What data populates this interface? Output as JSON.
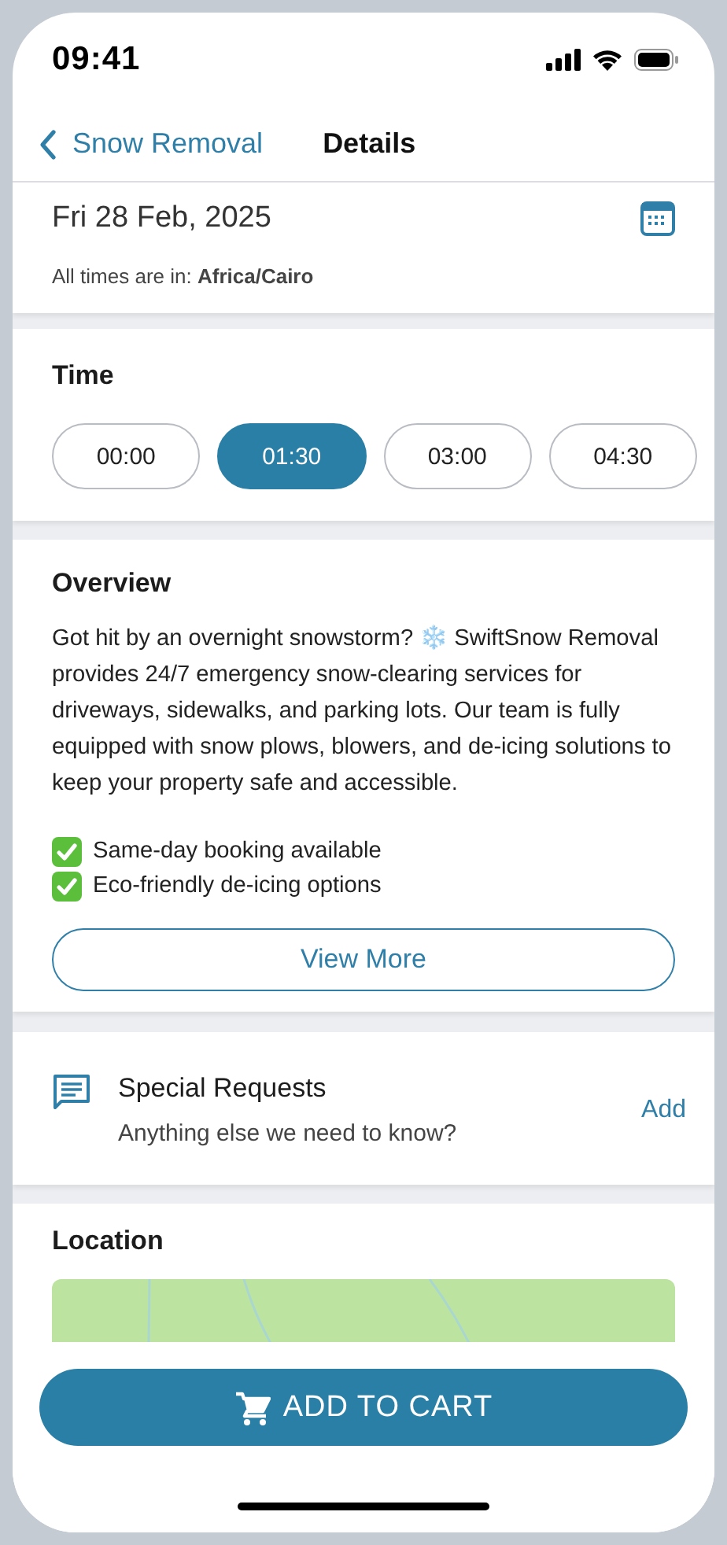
{
  "status_bar": {
    "time": "09:41"
  },
  "nav": {
    "back_label": "Snow Removal",
    "title": "Details"
  },
  "date": {
    "value": "Fri 28 Feb, 2025",
    "timezone": "All times are in: **Africa/Cairo**"
  },
  "time": {
    "heading": "Time",
    "slots": [
      {
        "label": "00:00",
        "selected": false
      },
      {
        "label": "01:30",
        "selected": true
      },
      {
        "label": "03:00",
        "selected": false
      },
      {
        "label": "04:30",
        "selected": false
      }
    ]
  },
  "overview": {
    "heading": "Overview",
    "description": "Got hit by an overnight snowstorm? ❄️ SwiftSnow Removal provides 24/7 emergency snow-clearing services for driveways, sidewalks, and parking lots. Our team is fully equipped with snow plows, blowers, and de-icing solutions to keep your property safe and accessible.",
    "highlights": [
      "Same-day booking available",
      "Eco-friendly de-icing options"
    ],
    "button": "View More"
  },
  "special_requests": {
    "title": "Special Requests",
    "subtitle": "Anything else we need to know?",
    "action": "Add"
  },
  "location": {
    "heading": "Location"
  },
  "footer": {
    "button": "ADD TO CART"
  }
}
